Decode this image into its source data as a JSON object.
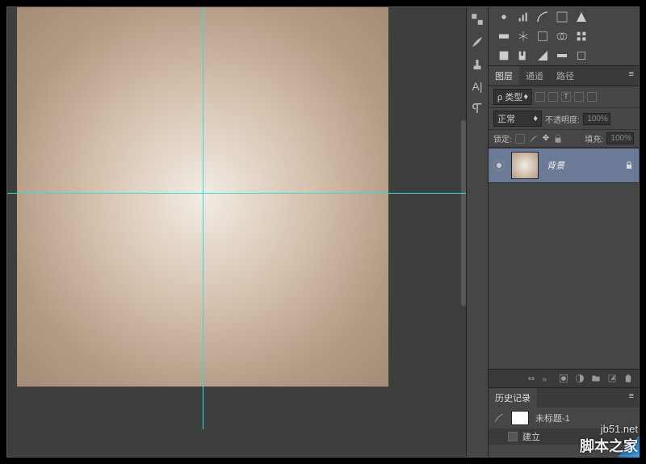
{
  "tabs": {
    "layers": "图层",
    "channels": "通道",
    "paths": "路径"
  },
  "filter": {
    "label": "类型"
  },
  "blend": {
    "mode": "正常",
    "opacity_lbl": "不透明度:",
    "opacity_val": "100%"
  },
  "lock": {
    "label": "锁定:",
    "fill_lbl": "填充:",
    "fill_val": "100%"
  },
  "layer": {
    "name": "背景"
  },
  "history": {
    "title": "历史记录",
    "doc": "未标题-1",
    "step": "建立"
  },
  "watermark": {
    "url": "jb51.net",
    "site": "脚本之家"
  }
}
